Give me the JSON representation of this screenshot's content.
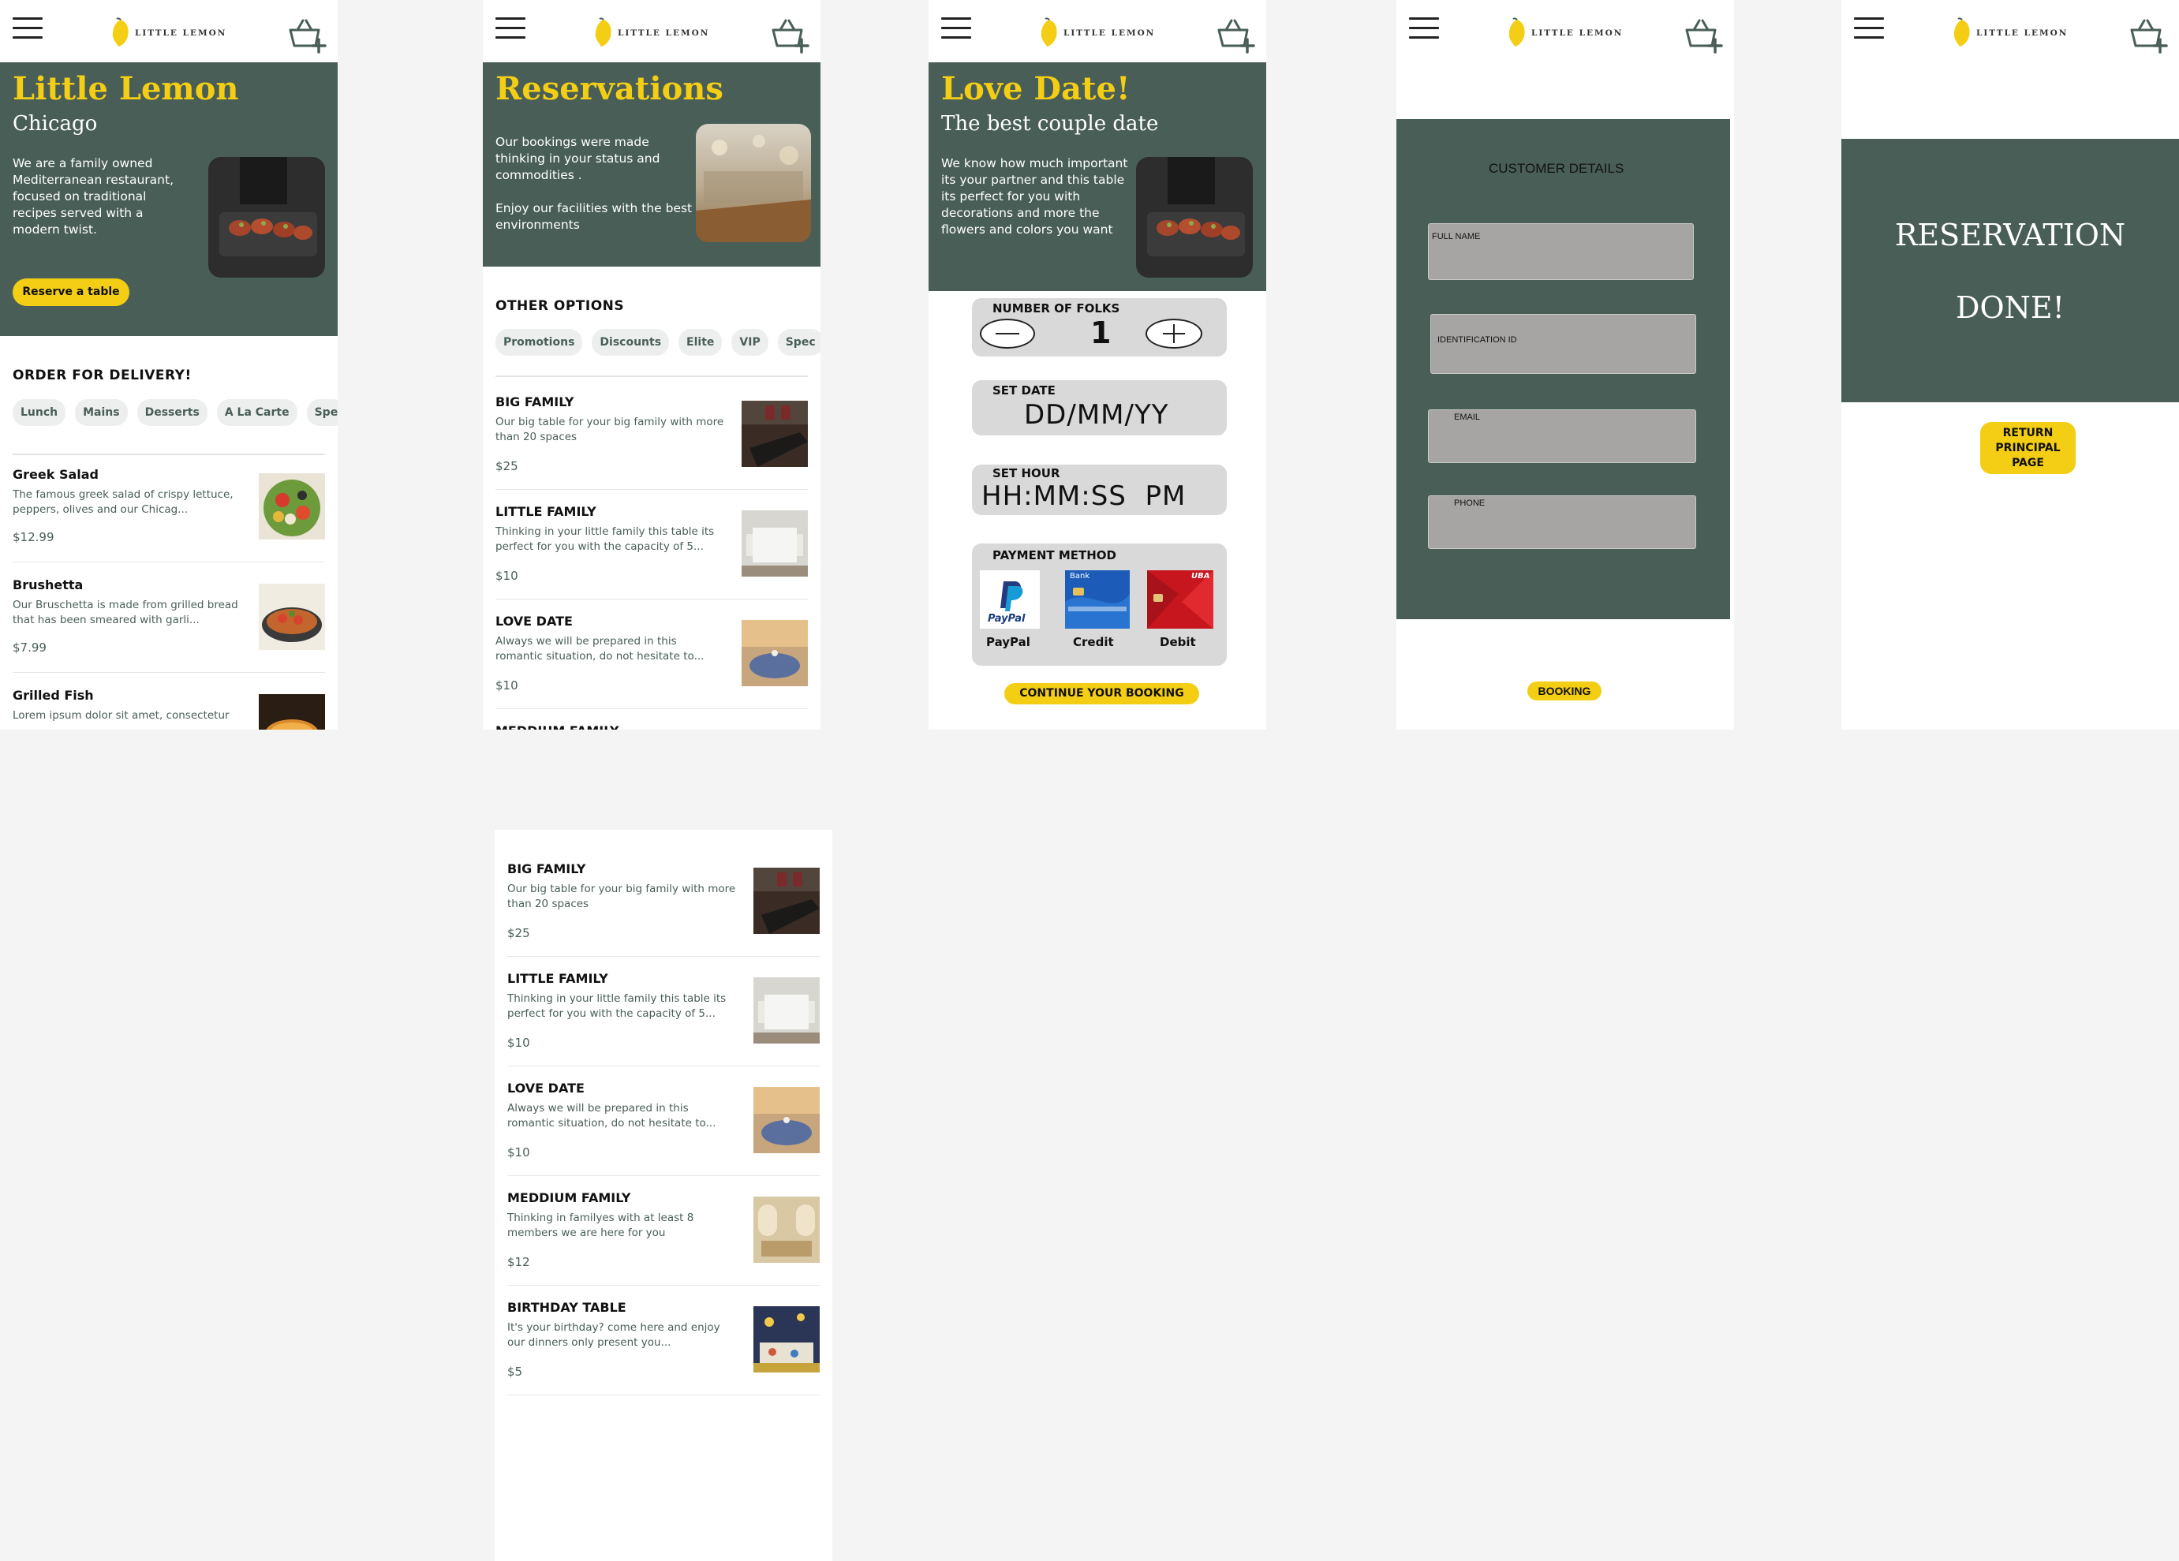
{
  "brand": {
    "logo_text": "LITTLE LEMON"
  },
  "colors": {
    "primary": "#495e57",
    "accent": "#f4ce14",
    "light": "#edefee"
  },
  "icons": {
    "menu": "hamburger-icon",
    "logo": "lemon-icon",
    "cart": "basket-plus-icon"
  },
  "home": {
    "title": "Little Lemon",
    "subtitle": "Chicago",
    "description": "We are a family owned Mediterranean restaurant, focused on traditional recipes served with a modern twist.",
    "cta": "Reserve a table",
    "section_title": "ORDER FOR DELIVERY!",
    "chips": [
      "Lunch",
      "Mains",
      "Desserts",
      "A La Carte",
      "Spe"
    ],
    "items": [
      {
        "name": "Greek Salad",
        "desc": "The famous greek salad of crispy lettuce, peppers, olives and our Chicag...",
        "price": "$12.99"
      },
      {
        "name": "Brushetta",
        "desc": "Our Bruschetta is made from grilled bread that has been smeared with garli...",
        "price": "$7.99"
      },
      {
        "name": "Grilled Fish",
        "desc": "Lorem ipsum dolor sit amet, consectetur",
        "price": ""
      }
    ]
  },
  "reservations": {
    "title": "Reservations",
    "description": "Our bookings were made thinking in your status  and commodities .\n\nEnjoy our facilities with the best environments",
    "section_title": "OTHER OPTIONS",
    "chips": [
      "Promotions",
      "Discounts",
      "Elite",
      "VIP",
      "Spec"
    ],
    "items": [
      {
        "name": "BIG FAMILY",
        "desc": "Our big table for your big family with more than 20 spaces",
        "price": "$25"
      },
      {
        "name": "LITTLE FAMILY",
        "desc": "Thinking in your little family this table its perfect for you with the capacity of 5...",
        "price": "$10"
      },
      {
        "name": "LOVE DATE",
        "desc": "Always we will be prepared in this romantic situation, do not hesitate to...",
        "price": "$10"
      },
      {
        "name": "MEDDIUM FAMILY",
        "desc": "",
        "price": ""
      }
    ]
  },
  "love_date": {
    "title": "Love Date!",
    "subtitle": "The best couple date",
    "description": "We know how much important its your partner and this table its perfect for you with decorations and more the flowers and colors you want",
    "folks_label": "NUMBER OF FOLKS",
    "folks_value": "1",
    "date_label": "SET DATE",
    "date_value": "DD/MM/YY",
    "hour_label": "SET HOUR",
    "hour_value": "HH:MM:SS  PM",
    "payment_label": "PAYMENT METHOD",
    "payment_options": [
      "PayPal",
      "Credit",
      "Debit"
    ],
    "paypal_logo": "PayPal",
    "debit_logo": "UBA",
    "card_logo": "Bank",
    "cta": "CONTINUE YOUR BOOKING"
  },
  "customer": {
    "title": "CUSTOMER DETAILS",
    "fields": [
      "FULL NAME",
      "IDENTIFICATION ID",
      "EMAIL",
      "PHONE"
    ],
    "cta": "BOOKING"
  },
  "done": {
    "line1": "RESERVATION",
    "line2": "DONE!",
    "cta": "RETURN PRINCIPAL PAGE"
  },
  "full_list": {
    "items": [
      {
        "name": "BIG FAMILY",
        "desc": "Our big table for your big family with more than 20 spaces",
        "price": "$25"
      },
      {
        "name": "LITTLE FAMILY",
        "desc": "Thinking in your little family this table its perfect for you with the capacity of 5...",
        "price": "$10"
      },
      {
        "name": "LOVE DATE",
        "desc": "Always we will be prepared in this romantic situation, do not hesitate to...",
        "price": "$10"
      },
      {
        "name": "MEDDIUM FAMILY",
        "desc": "Thinking in familyes with at least 8 members we are here for you",
        "price": "$12"
      },
      {
        "name": "BIRTHDAY TABLE",
        "desc": "It's your birthday? come here and enjoy our dinners only present you...",
        "price": "$5"
      }
    ]
  }
}
